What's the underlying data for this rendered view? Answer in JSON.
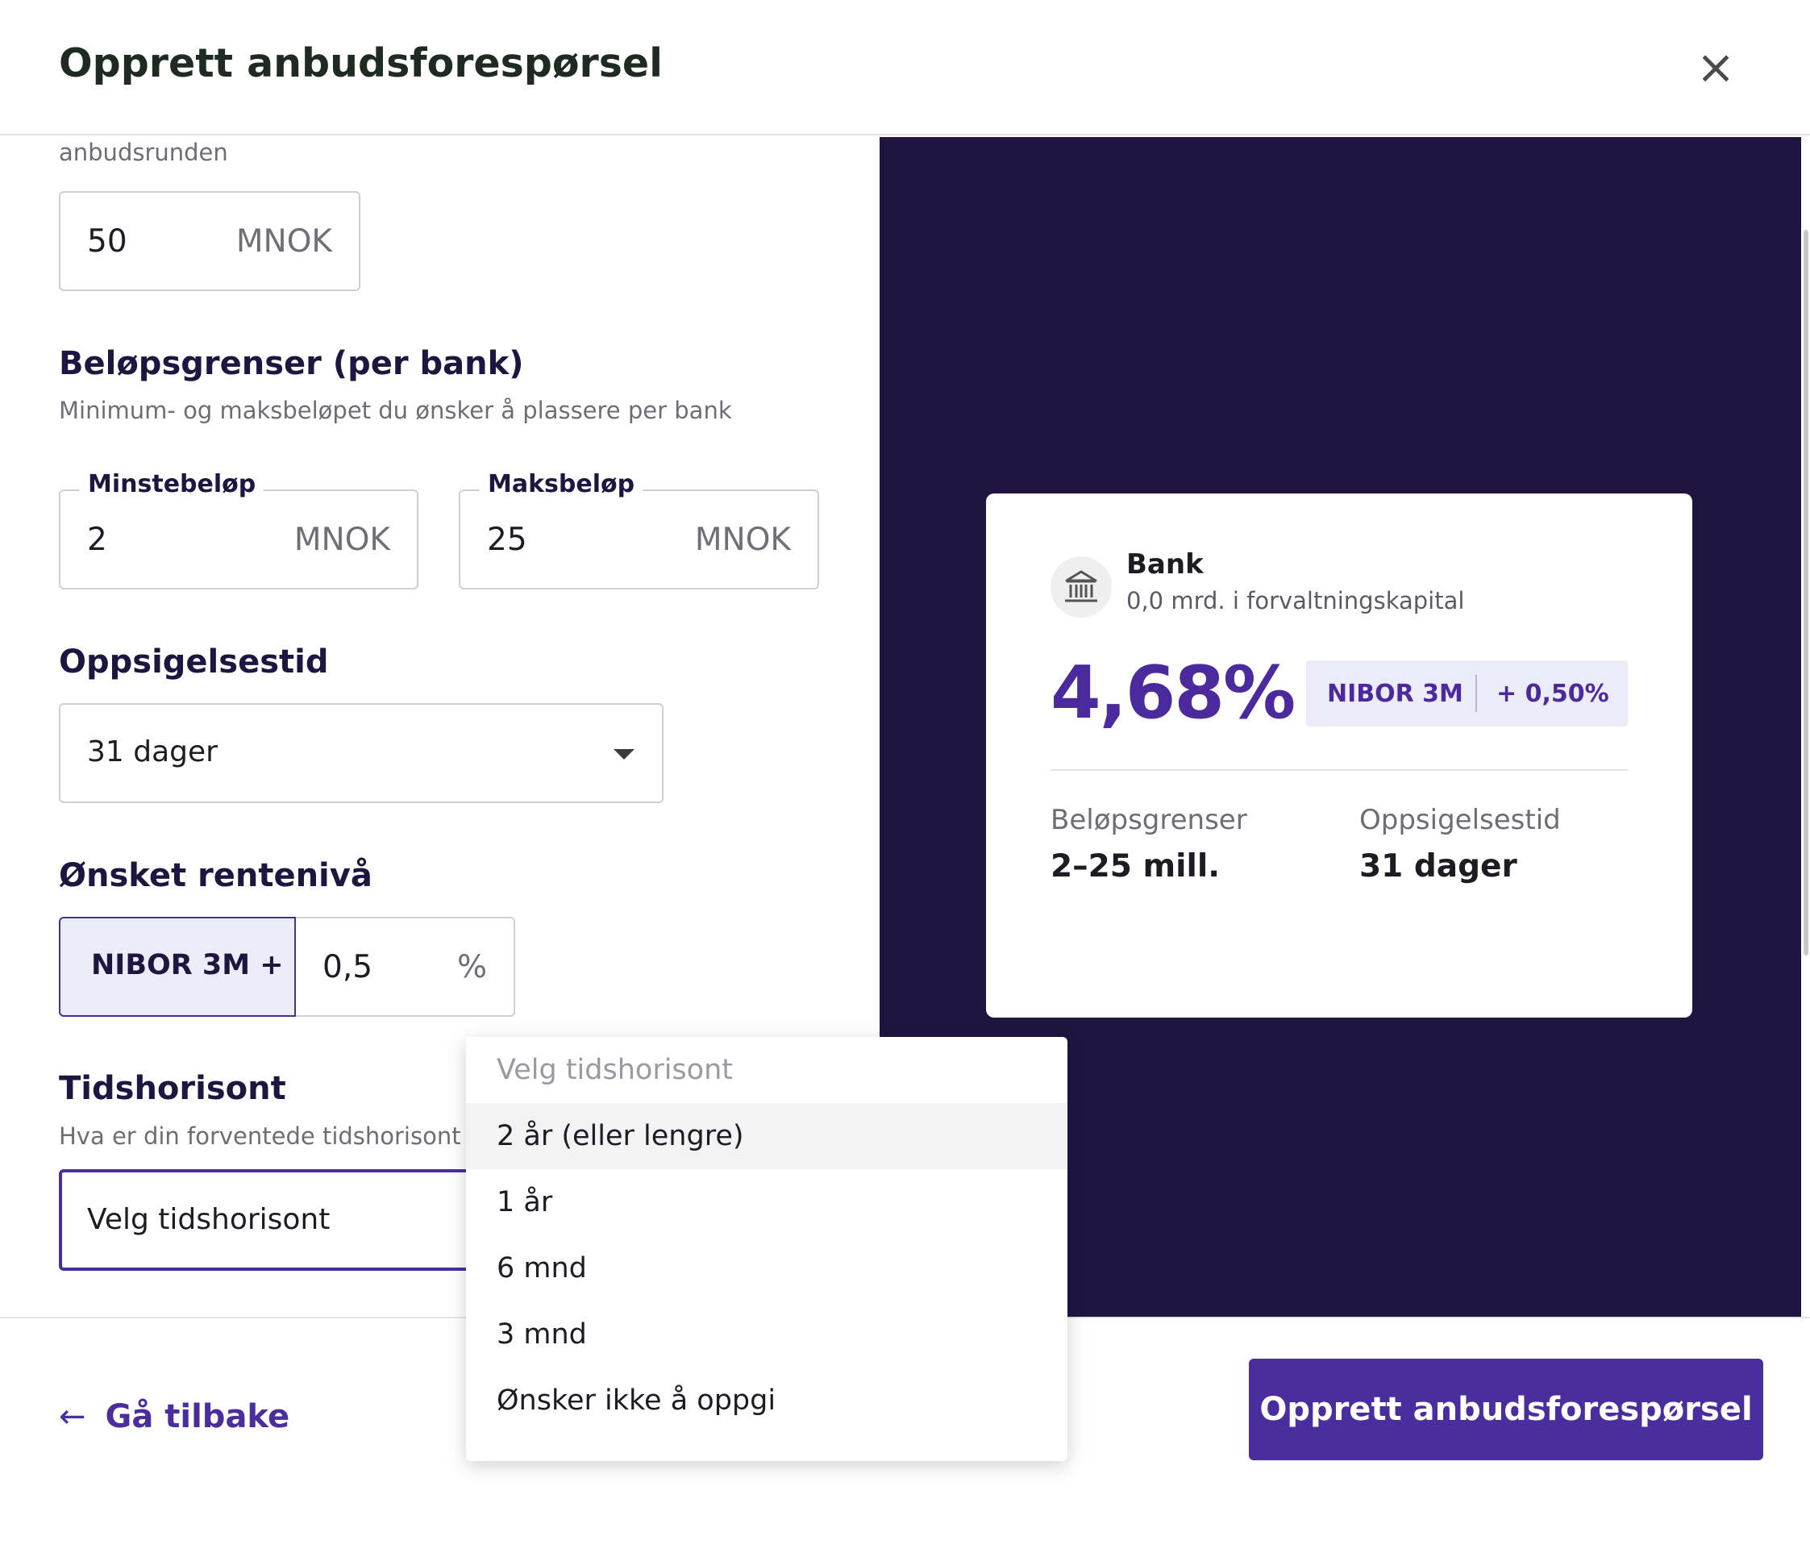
{
  "modal": {
    "title": "Opprett anbudsforespørsel",
    "close_symbol": "×"
  },
  "form": {
    "partial_label": "anbudsrunden",
    "total_amount": {
      "value": "50",
      "unit": "MNOK"
    },
    "limits": {
      "title": "Beløpsgrenser (per bank)",
      "description": "Minimum- og maksbeløpet du ønsker å plassere per bank",
      "min": {
        "label": "Minstebeløp",
        "value": "2",
        "unit": "MNOK"
      },
      "max": {
        "label": "Maksbeløp",
        "value": "25",
        "unit": "MNOK"
      }
    },
    "notice": {
      "title": "Oppsigelsestid",
      "selected": "31 dager"
    },
    "rate": {
      "title": "Ønsket rentenivå",
      "prefix": "NIBOR 3M +",
      "value": "0,5",
      "unit": "%"
    },
    "horizon": {
      "title": "Tidshorisont",
      "description": "Hva er din forventede tidshorisont",
      "selected": "Velg tidshorisont",
      "options": [
        "Velg tidshorisont",
        "2 år (eller lengre)",
        "1 år",
        "6 mnd",
        "3 mnd",
        "Ønsker ikke å oppgi"
      ],
      "highlighted_index": 1
    }
  },
  "preview": {
    "icon": "bank-icon",
    "bank_name": "Bank",
    "bank_capital": "0,0 mrd. i forvaltningskapital",
    "rate": "4,68%",
    "reference": "NIBOR 3M",
    "margin": "+ 0,50%",
    "stats": [
      {
        "label": "Beløpsgrenser",
        "value": "2–25 mill."
      },
      {
        "label": "Oppsigelsestid",
        "value": "31 dager"
      }
    ]
  },
  "footer": {
    "back_label": "Gå tilbake",
    "back_icon": "arrow-left-icon",
    "submit_label": "Opprett anbudsforespørsel"
  },
  "colors": {
    "brand": "#4a2e9e",
    "preview_background": "#201541",
    "accent_light": "#ecebf8",
    "title_text": "#1f2b22"
  }
}
